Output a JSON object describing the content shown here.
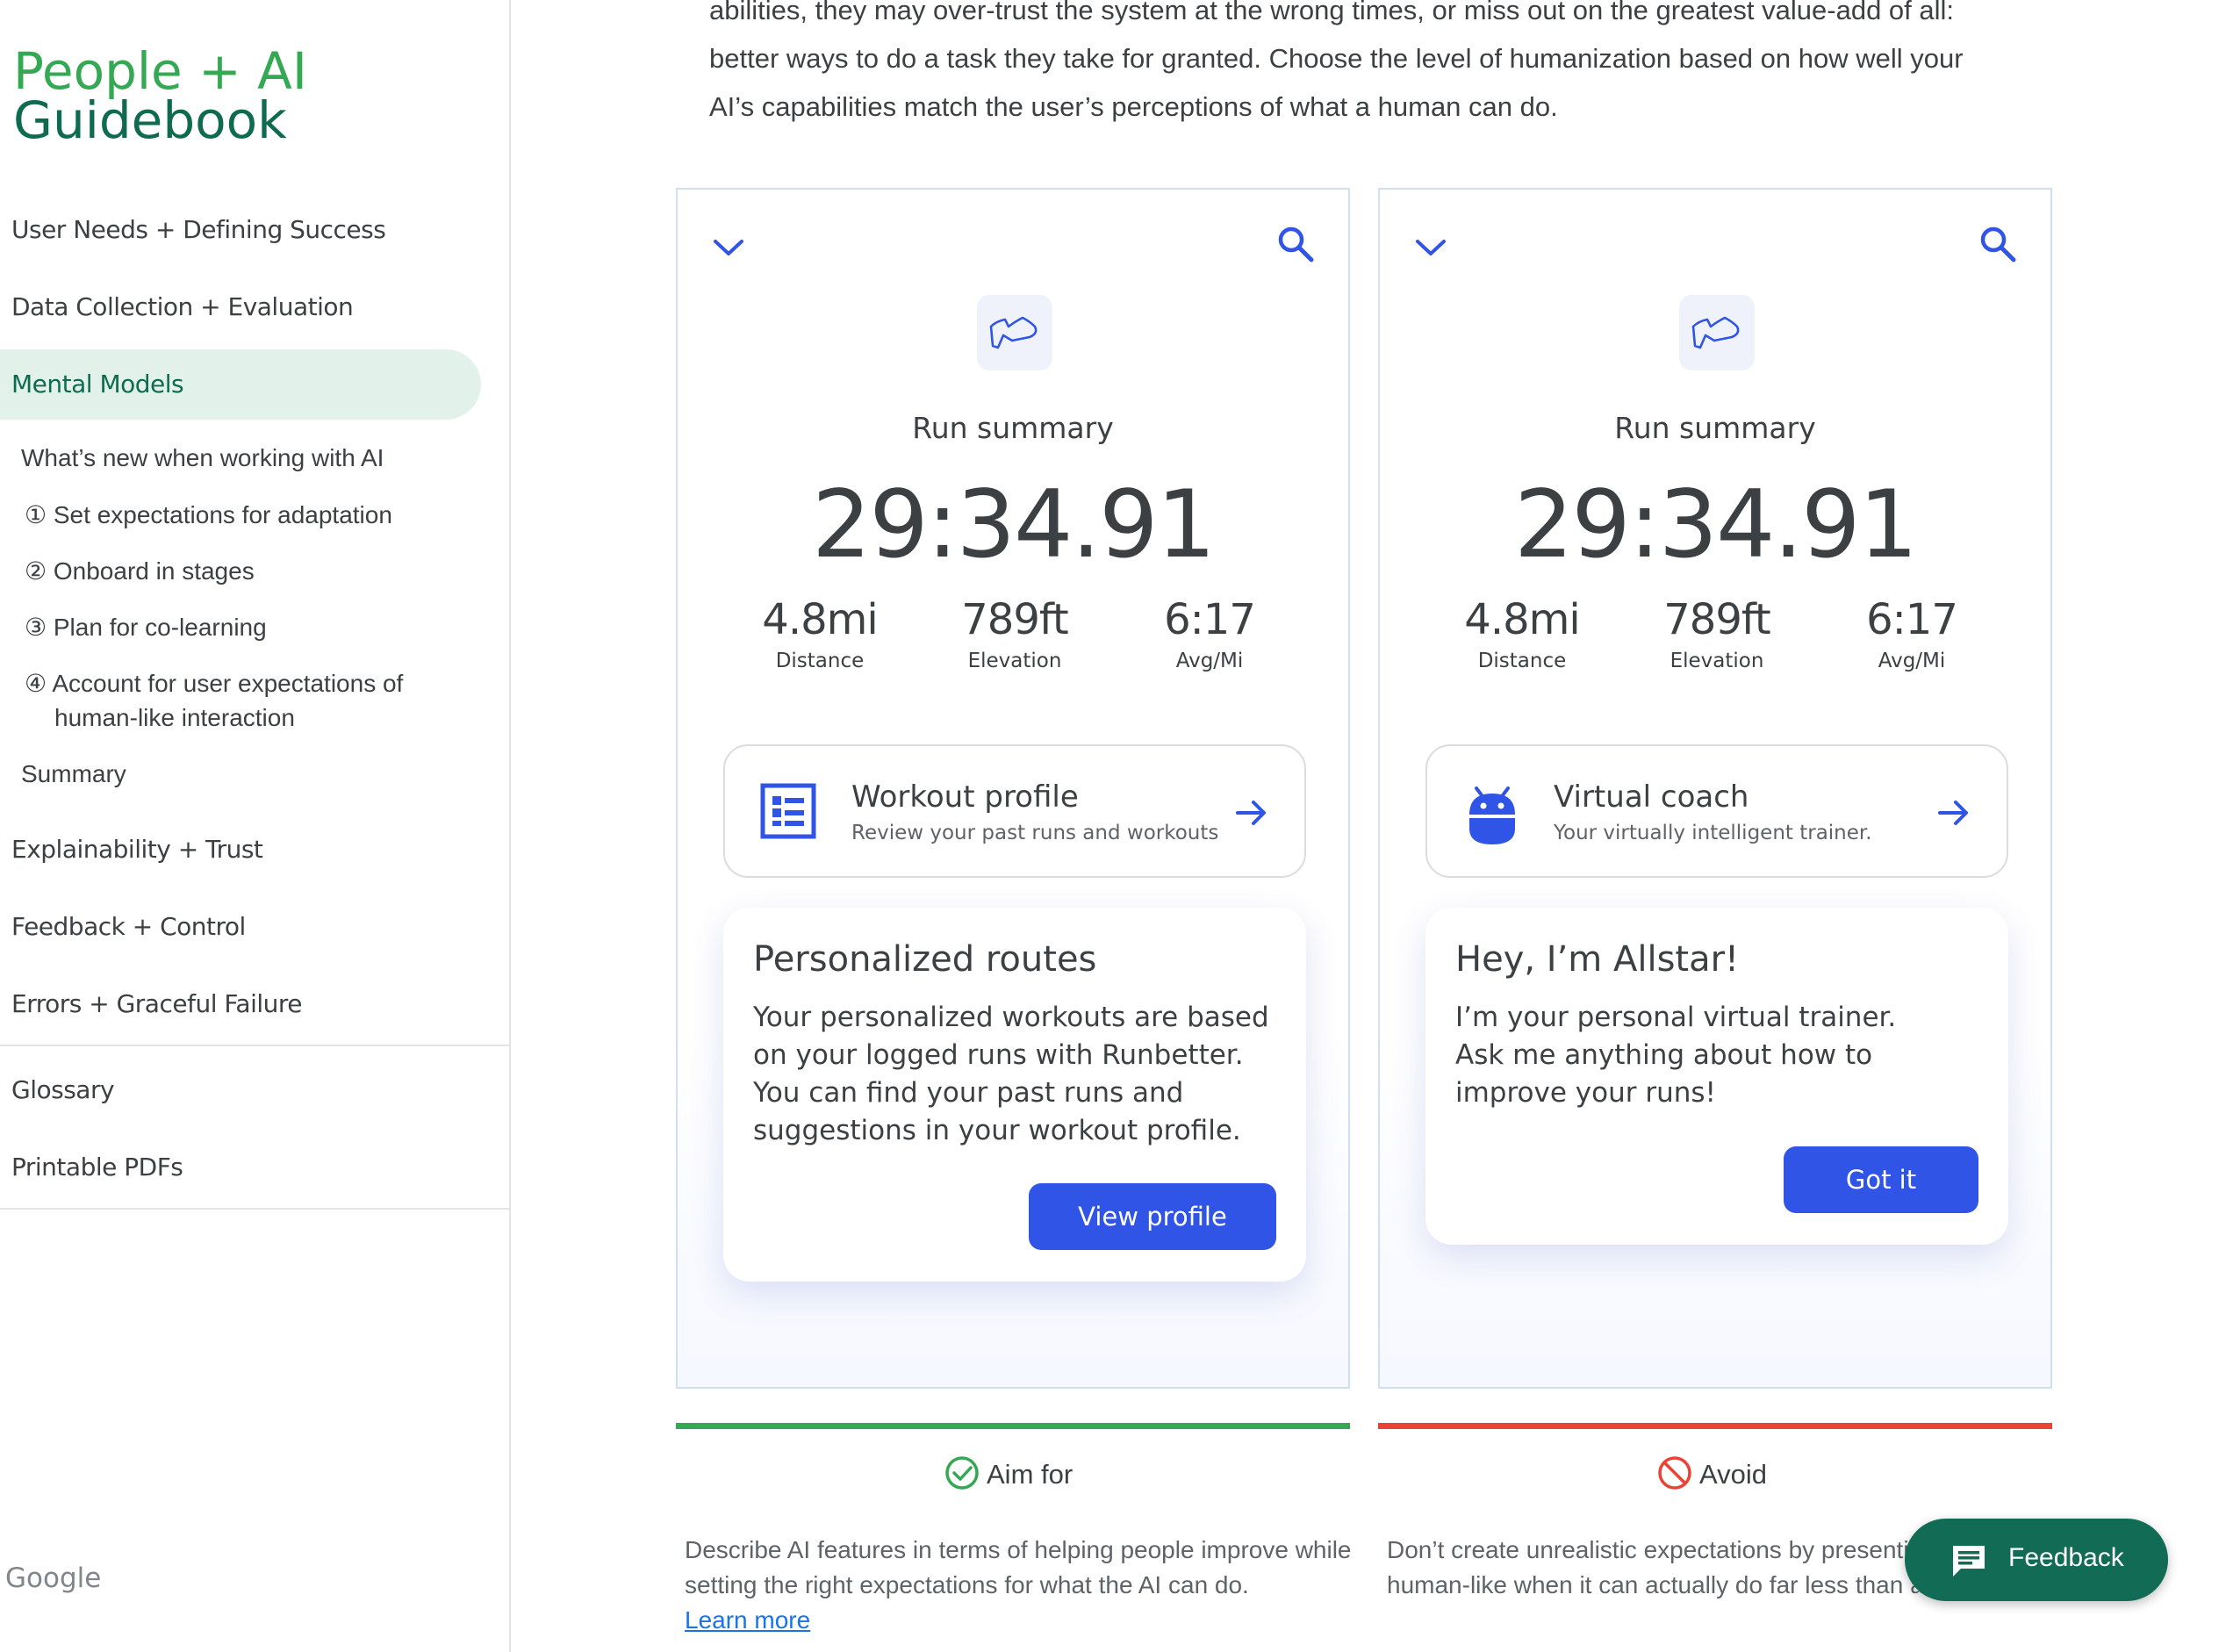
{
  "logo": {
    "line1": "People + AI",
    "line2": "Guidebook"
  },
  "sidebar": {
    "main_items": [
      {
        "label": "User Needs + Defining Success"
      },
      {
        "label": "Data Collection + Evaluation"
      },
      {
        "label": "Mental Models"
      }
    ],
    "sub_items": [
      {
        "label": "What’s new when working with AI"
      },
      {
        "label": "① Set expectations for adaptation"
      },
      {
        "label": "② Onboard in stages"
      },
      {
        "label": "③ Plan for co-learning"
      },
      {
        "label": "④ Account for user expectations of",
        "label2": "human-like interaction"
      },
      {
        "label": "Summary"
      }
    ],
    "more_items": [
      {
        "label": "Explainability + Trust"
      },
      {
        "label": "Feedback + Control"
      },
      {
        "label": "Errors + Graceful Failure"
      }
    ],
    "extra_items": [
      {
        "label": "Glossary"
      },
      {
        "label": "Printable PDFs"
      }
    ],
    "footer": "Google"
  },
  "main": {
    "paragraph": [
      "abilities, they may over-trust the system at the wrong times, or miss out on the greatest value-add of all:",
      "better ways to do a task they take for granted. Choose the level of humanization based on how well your",
      "AI’s capabilities match the user’s perceptions of what a human can do."
    ]
  },
  "panels": [
    {
      "title": "Run summary",
      "time": "29:34.91",
      "stats": [
        {
          "value": "4.8mi",
          "label": "Distance"
        },
        {
          "value": "789ft",
          "label": "Elevation"
        },
        {
          "value": "6:17",
          "label": "Avg/Mi"
        }
      ],
      "card": {
        "title": "Workout profile",
        "subtitle": "Review your past runs and workouts",
        "icon": "list-icon"
      },
      "popup": {
        "title": "Personalized routes",
        "body": "Your personalized workouts are based on your logged runs with Runbetter. You can find your past runs and suggestions in your workout profile.",
        "button": "View profile"
      },
      "verdict": "Aim for",
      "verdict_color": "#34a853",
      "description": "Describe AI features in terms of helping people improve while setting the right expectations for what the AI can do.",
      "link": "Learn more"
    },
    {
      "title": "Run summary",
      "time": "29:34.91",
      "stats": [
        {
          "value": "4.8mi",
          "label": "Distance"
        },
        {
          "value": "789ft",
          "label": "Elevation"
        },
        {
          "value": "6:17",
          "label": "Avg/Mi"
        }
      ],
      "card": {
        "title": "Virtual coach",
        "subtitle": "Your virtually intelligent trainer.",
        "icon": "robot-icon"
      },
      "popup": {
        "title": "Hey, I’m Allstar!",
        "body": "I’m your personal virtual trainer. Ask me anything about how to improve your runs!",
        "button": "Got it"
      },
      "verdict": "Avoid",
      "verdict_color": "#ea4335",
      "description": "Don’t create unrealistic expectations by presenting AI as human-like when it can actually do far less than a person."
    }
  ],
  "feedback_button": "Feedback",
  "colors": {
    "accent_blue": "#3055e6",
    "brand_green": "#0f6b4f",
    "active_bg": "#e2f2ea"
  }
}
